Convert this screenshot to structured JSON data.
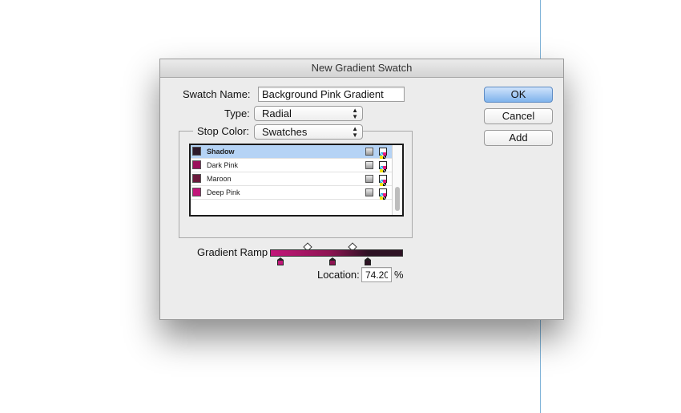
{
  "dialog": {
    "title": "New Gradient Swatch",
    "swatch_name_label": "Swatch Name:",
    "swatch_name_value": "Background Pink Gradient",
    "type_label": "Type:",
    "type_value": "Radial",
    "stop_color_label": "Stop Color:",
    "stop_color_value": "Swatches",
    "swatches": [
      {
        "name": "Shadow",
        "color": "#2e1b2c",
        "selected": true
      },
      {
        "name": "Dark Pink",
        "color": "#9a0f5a",
        "selected": false
      },
      {
        "name": "Maroon",
        "color": "#6b1a3c",
        "selected": false
      },
      {
        "name": "Deep Pink",
        "color": "#c2177a",
        "selected": false
      }
    ],
    "gradient_ramp_label": "Gradient Ramp",
    "location_label": "Location:",
    "location_value": "74.20",
    "location_unit": "%",
    "stops": [
      {
        "color": "#c2177a",
        "location": 0
      },
      {
        "color": "#8e1452",
        "location": 45
      },
      {
        "color": "#2e1224",
        "location": 74.2
      }
    ],
    "midpoints": [
      25,
      62
    ]
  },
  "buttons": {
    "ok": "OK",
    "cancel": "Cancel",
    "add": "Add"
  },
  "colors": {
    "accent": "#7fb3ec",
    "selection": "#b5d3f5",
    "guide": "#7fb3d8"
  }
}
